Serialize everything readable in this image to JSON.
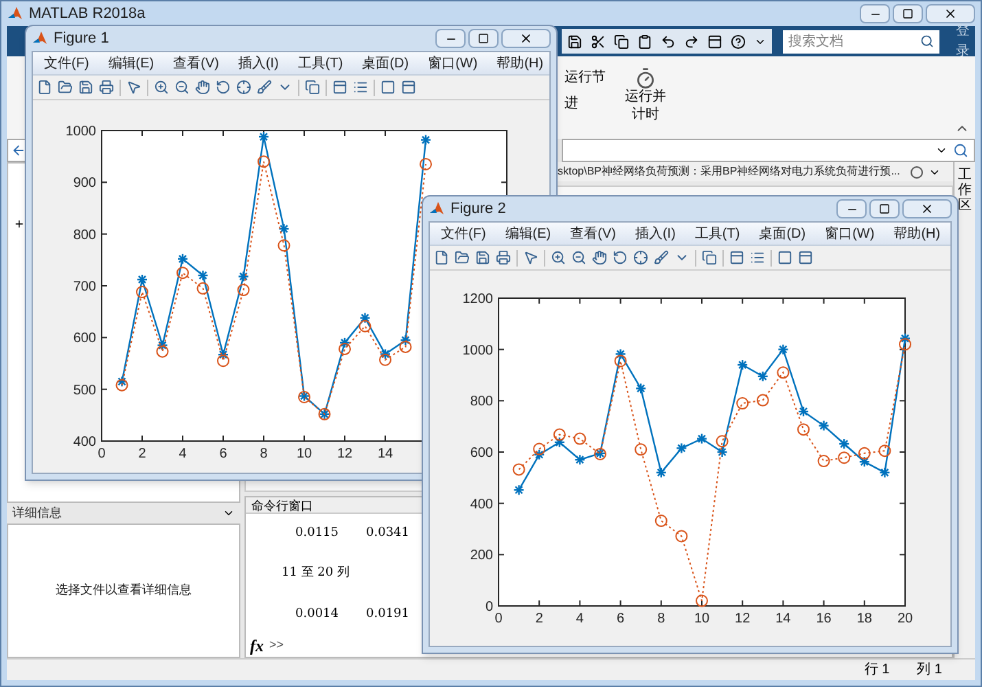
{
  "main_window": {
    "title": "MATLAB R2018a"
  },
  "search": {
    "placeholder": "搜索文档"
  },
  "login_button": "登录",
  "ribbon": {
    "small_buttons": [
      {
        "label": "运行节"
      },
      {
        "label": "进"
      }
    ],
    "big_button": {
      "label": "运行并计时"
    }
  },
  "editor": {
    "path": "sktop\\BP神经网络负荷预测：采用BP神经网络对电力系统负荷进行预..."
  },
  "side_tab": "工作区",
  "details_panel": {
    "title": "详细信息",
    "message": "选择文件以查看详细信息"
  },
  "command_window": {
    "title": "命令行窗口",
    "lines": [
      {
        "kind": "values",
        "values": [
          "0.0115",
          "0.0341"
        ]
      },
      {
        "kind": "header",
        "text": "11 至 20 列"
      },
      {
        "kind": "values",
        "values": [
          "0.0014",
          "0.0191"
        ]
      }
    ],
    "fx": "fx",
    "prompt": ">>"
  },
  "status_bar": {
    "row": "行 1",
    "col": "列 1"
  },
  "figures": [
    {
      "title": "Figure 1",
      "menu": [
        "文件(F)",
        "编辑(E)",
        "查看(V)",
        "插入(I)",
        "工具(T)",
        "桌面(D)",
        "窗口(W)",
        "帮助(H)"
      ],
      "chart_data": {
        "type": "line",
        "x": [
          1,
          2,
          3,
          4,
          5,
          6,
          7,
          8,
          9,
          10,
          11,
          12,
          13,
          14,
          15,
          16
        ],
        "series": [
          {
            "color": "#0072bd",
            "marker": "cross",
            "line_style": "solid",
            "values": [
              515,
              712,
              585,
              752,
              720,
              567,
              718,
              988,
              810,
              487,
              452,
              590,
              638,
              568,
              595,
              982
            ]
          },
          {
            "color": "#d95319",
            "marker": "circle",
            "line_style": "dotted",
            "values": [
              508,
              688,
              573,
              725,
              695,
              555,
              692,
              940,
              778,
              485,
              452,
              578,
              622,
              557,
              582,
              935
            ]
          }
        ],
        "xlim": [
          0,
          20
        ],
        "ylim": [
          400,
          1000
        ],
        "xticks": [
          0,
          2,
          4,
          6,
          8,
          10,
          12,
          14
        ],
        "yticks": [
          400,
          500,
          600,
          700,
          800,
          900,
          1000
        ]
      }
    },
    {
      "title": "Figure 2",
      "menu": [
        "文件(F)",
        "编辑(E)",
        "查看(V)",
        "插入(I)",
        "工具(T)",
        "桌面(D)",
        "窗口(W)",
        "帮助(H)"
      ],
      "chart_data": {
        "type": "line",
        "x": [
          1,
          2,
          3,
          4,
          5,
          6,
          7,
          8,
          9,
          10,
          11,
          12,
          13,
          14,
          15,
          16,
          17,
          18,
          19,
          20
        ],
        "series": [
          {
            "color": "#0072bd",
            "marker": "cross",
            "line_style": "solid",
            "values": [
              452,
              590,
              638,
              570,
              595,
              982,
              848,
              520,
              615,
              652,
              600,
              940,
              895,
              1000,
              758,
              703,
              632,
              562,
              520,
              1043
            ]
          },
          {
            "color": "#d95319",
            "marker": "circle",
            "line_style": "dotted",
            "values": [
              532,
              612,
              668,
              652,
              592,
              955,
              610,
              332,
              272,
              20,
              642,
              790,
              802,
              910,
              688,
              565,
              578,
              595,
              605,
              1020
            ]
          }
        ],
        "xlim": [
          0,
          20
        ],
        "ylim": [
          0,
          1200
        ],
        "xticks": [
          0,
          2,
          4,
          6,
          8,
          10,
          12,
          14,
          16,
          18,
          20
        ],
        "yticks": [
          0,
          200,
          400,
          600,
          800,
          1000,
          1200
        ]
      }
    }
  ]
}
